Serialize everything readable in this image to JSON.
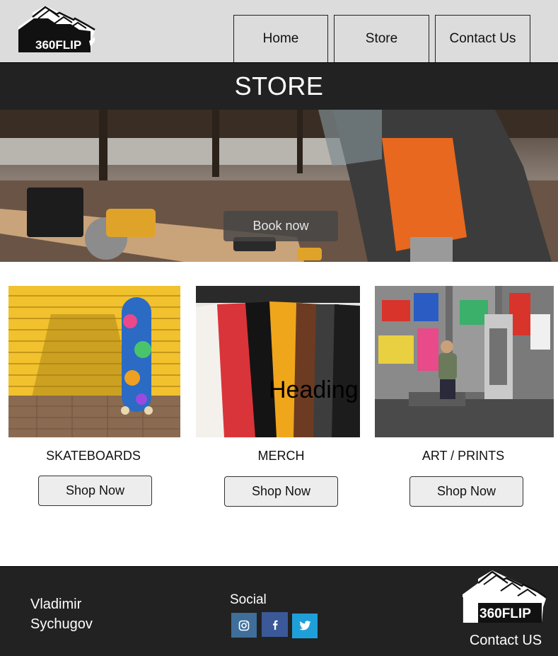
{
  "brand": {
    "logo_text": "360FLIP"
  },
  "nav": {
    "home": "Home",
    "store": "Store",
    "contact": "Contact Us"
  },
  "page": {
    "title": "STORE"
  },
  "hero": {
    "button": "Book now"
  },
  "products": [
    {
      "label": "SKATEBOARDS",
      "button": "Shop Now"
    },
    {
      "label": "MERCH",
      "button": "Shop Now",
      "overlay_heading": "Heading"
    },
    {
      "label": "ART / PRINTS",
      "button": "Shop Now"
    }
  ],
  "footer": {
    "author_first": "Vladimir",
    "author_last": "Sychugov",
    "social_title": "Social",
    "contact": "Contact US",
    "social_icons": [
      "instagram-icon",
      "facebook-icon",
      "twitter-icon"
    ]
  },
  "colors": {
    "header_bg": "#dcdcdc",
    "dark_band": "#222222",
    "instagram": "#3f6e9a",
    "facebook": "#3b5998",
    "twitter": "#1f9fd8"
  }
}
